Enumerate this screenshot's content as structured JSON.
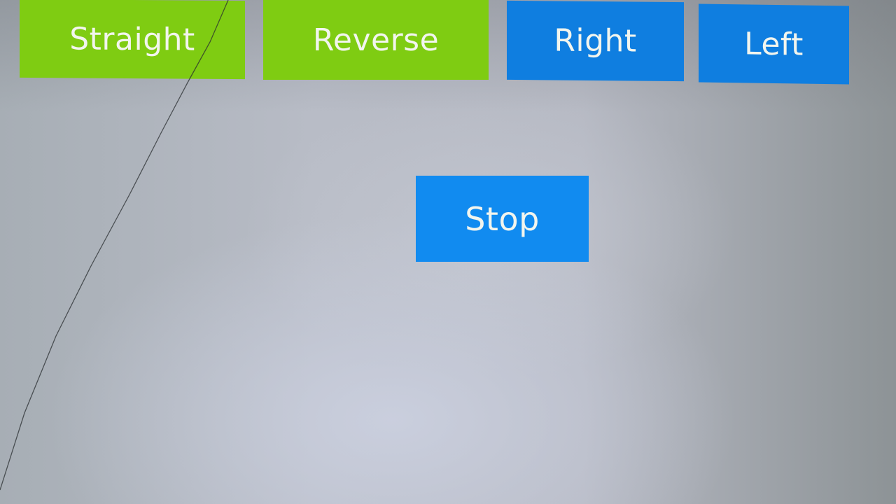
{
  "buttons": {
    "straight": "Straight",
    "reverse": "Reverse",
    "right": "Right",
    "left": "Left",
    "stop": "Stop"
  },
  "colors": {
    "green": "#7fcc12",
    "blue": "#0f7ee0",
    "stop_blue": "#118bf0",
    "label": "#f2f5ee"
  }
}
